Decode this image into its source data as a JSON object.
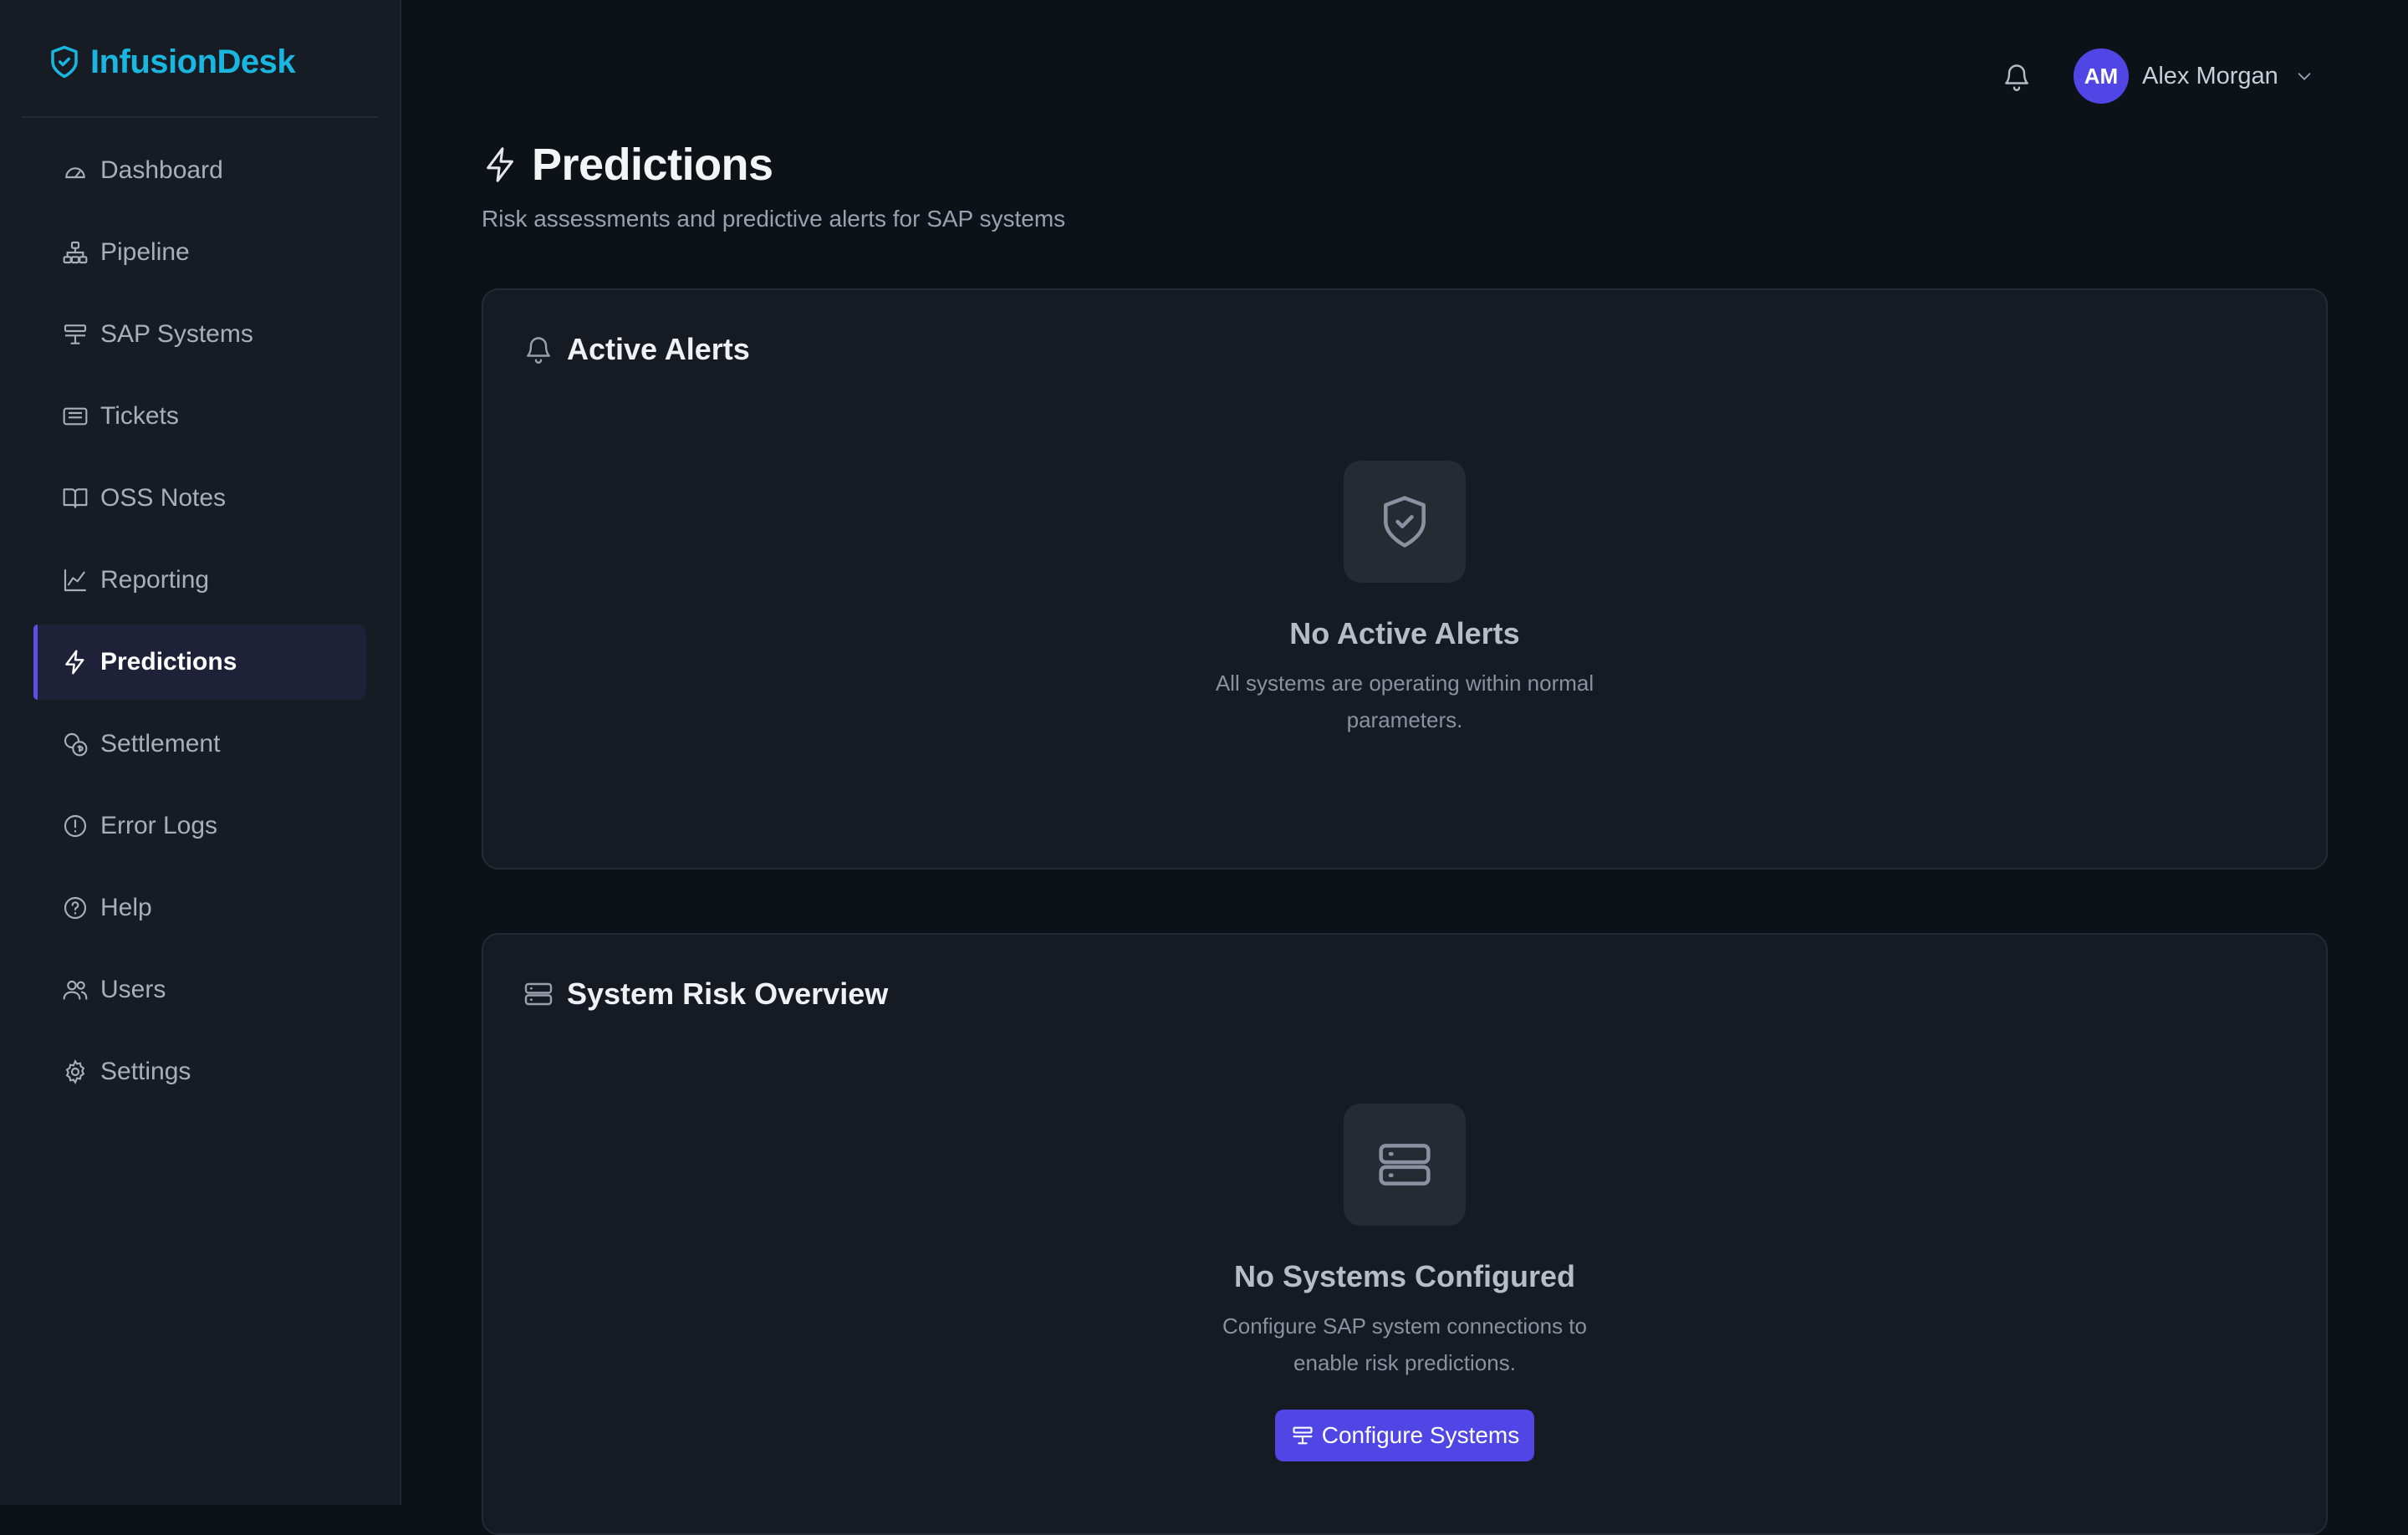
{
  "brand": {
    "name": "InfusionDesk",
    "color": "#19b6e0"
  },
  "sidebar": {
    "items": [
      {
        "label": "Dashboard",
        "icon": "gauge-icon"
      },
      {
        "label": "Pipeline",
        "icon": "sitemap-icon"
      },
      {
        "label": "SAP Systems",
        "icon": "server-icon"
      },
      {
        "label": "Tickets",
        "icon": "ticket-icon"
      },
      {
        "label": "OSS Notes",
        "icon": "book-open-icon"
      },
      {
        "label": "Reporting",
        "icon": "line-chart-icon"
      },
      {
        "label": "Predictions",
        "icon": "zap-icon",
        "active": true
      },
      {
        "label": "Settlement",
        "icon": "coins-icon"
      },
      {
        "label": "Error Logs",
        "icon": "alert-circle-icon"
      },
      {
        "label": "Help",
        "icon": "help-circle-icon"
      },
      {
        "label": "Users",
        "icon": "users-icon"
      },
      {
        "label": "Settings",
        "icon": "gear-icon"
      }
    ]
  },
  "header": {
    "user": {
      "initials": "AM",
      "name": "Alex Morgan"
    }
  },
  "page": {
    "title": "Predictions",
    "subtitle": "Risk assessments and predictive alerts for SAP systems"
  },
  "alerts_card": {
    "title": "Active Alerts",
    "empty_title": "No Active Alerts",
    "empty_text": "All systems are operating within normal parameters."
  },
  "risk_card": {
    "title": "System Risk Overview",
    "empty_title": "No Systems Configured",
    "empty_text": "Configure SAP system connections to enable risk predictions.",
    "button_label": "Configure Systems"
  },
  "colors": {
    "accent": "#4f46e5",
    "active_bg": "#1e2138",
    "background": "#0d1118"
  }
}
